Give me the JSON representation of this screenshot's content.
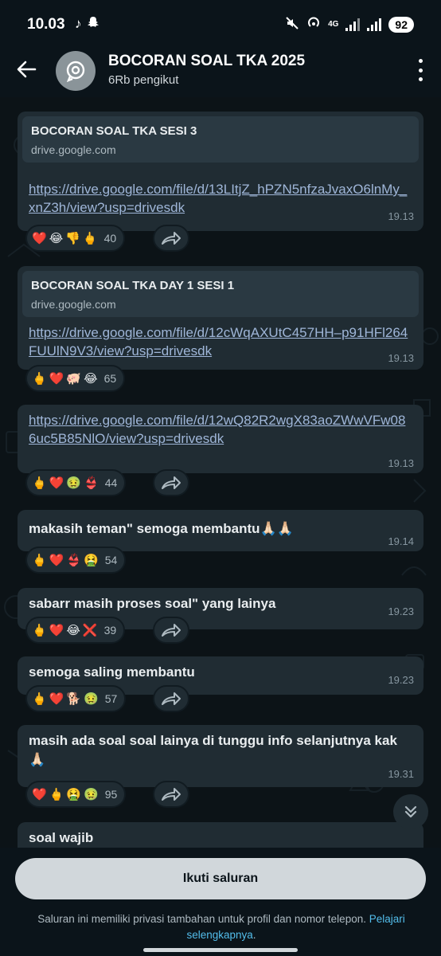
{
  "status_bar": {
    "time": "10.03",
    "left_icons": [
      "tiktok-icon",
      "snapchat-icon"
    ],
    "network": "4G",
    "battery": "92"
  },
  "header": {
    "title": "BOCORAN SOAL TKA 2025",
    "subtitle": "6Rb pengikut"
  },
  "messages": [
    {
      "preview_title": "BOCORAN SOAL TKA SESI 3",
      "preview_domain": "drive.google.com",
      "link": "https://drive.google.com/file/d/13LItjZ_hPZN5nfzaJvaxO6lnMy_xnZ3h/view?usp=drivesdk",
      "time": "19.13",
      "reactions": [
        "❤️",
        "😂",
        "👎",
        "🖕"
      ],
      "count": "40"
    },
    {
      "preview_title": "BOCORAN SOAL TKA DAY 1 SESI 1",
      "preview_domain": "drive.google.com",
      "link": "https://drive.google.com/file/d/12cWqAXUtC457HH–p91HFl264FUUlN9V3/view?usp=drivesdk",
      "time": "19.13",
      "reactions": [
        "🖕",
        "❤️",
        "🐖",
        "😂"
      ],
      "count": "65"
    },
    {
      "link": "https://drive.google.com/file/d/12wQ82R2wgX83aoZWwVFw086uc5B85NlO/view?usp=drivesdk",
      "time": "19.13",
      "reactions": [
        "🖕",
        "❤️",
        "🤢",
        "👙"
      ],
      "count": "44"
    },
    {
      "text": "makasih teman\" semoga membantu🙏🏻🙏🏻",
      "time": "19.14",
      "reactions": [
        "🖕",
        "❤️",
        "👙",
        "🤮"
      ],
      "count": "54"
    },
    {
      "text": "sabarr masih proses soal\" yang lainya",
      "time": "19.23",
      "reactions": [
        "🖕",
        "❤️",
        "😂",
        "❌"
      ],
      "count": "39"
    },
    {
      "text": "semoga saling membantu",
      "time": "19.23",
      "reactions": [
        "🖕",
        "❤️",
        "🐕",
        "🤢"
      ],
      "count": "57"
    },
    {
      "text": "masih ada soal soal lainya di tunggu info selanjutnya kak 🙏🏻",
      "time": "19.31",
      "reactions": [
        "❤️",
        "🖕",
        "🤮",
        "🤢"
      ],
      "count": "95"
    },
    {
      "text": "soal wajib"
    }
  ],
  "bottom": {
    "follow_label": "Ikuti saluran",
    "privacy_text": "Saluran ini memiliki privasi tambahan untuk profil dan nomor telepon. ",
    "privacy_link": "Pelajari selengkapnya",
    "privacy_end": "."
  },
  "colors": {
    "background": "#0b141a",
    "bubble": "#202c33",
    "link": "#9fb6d8",
    "accent_link": "#53bdeb"
  }
}
